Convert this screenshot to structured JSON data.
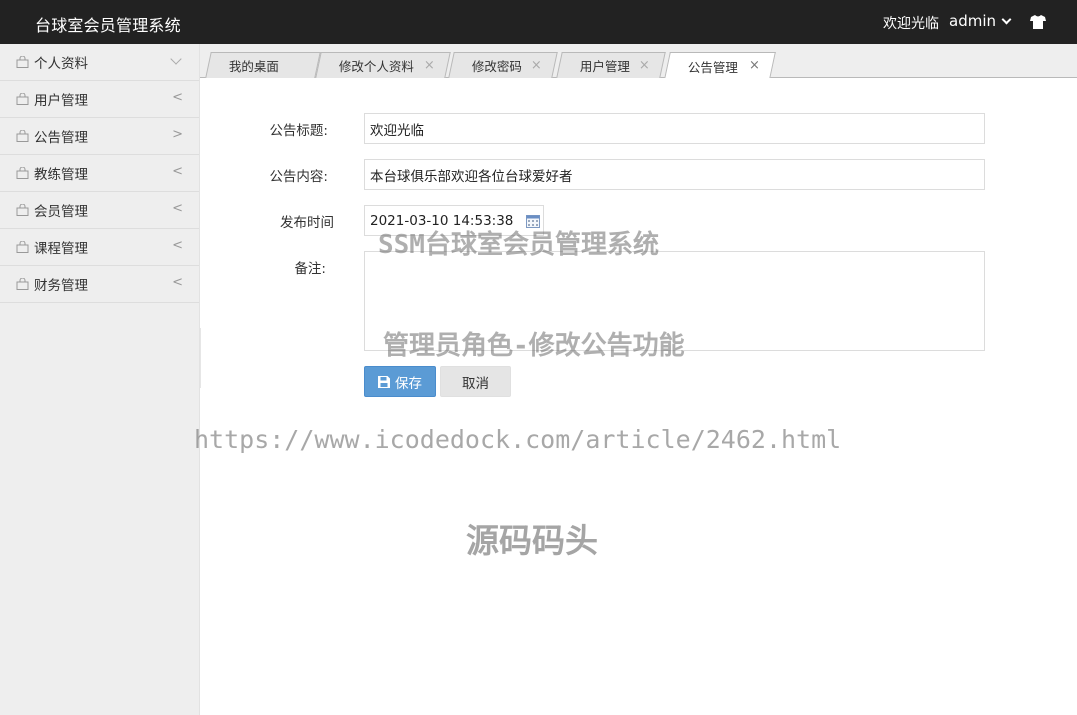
{
  "header": {
    "app_title": "台球室会员管理系统",
    "welcome": "欢迎光临",
    "username": "admin",
    "skin_icon": "tshirt-icon"
  },
  "sidebar": {
    "items": [
      {
        "label": "个人资料",
        "arrow": "v"
      },
      {
        "label": "用户管理",
        "arrow": "<"
      },
      {
        "label": "公告管理",
        "arrow": ">"
      },
      {
        "label": "教练管理",
        "arrow": "<"
      },
      {
        "label": "会员管理",
        "arrow": "<"
      },
      {
        "label": "课程管理",
        "arrow": "<"
      },
      {
        "label": "财务管理",
        "arrow": "<"
      }
    ]
  },
  "tabs": [
    {
      "label": "我的桌面",
      "closable": false,
      "active": false
    },
    {
      "label": "修改个人资料",
      "closable": true,
      "active": false
    },
    {
      "label": "修改密码",
      "closable": true,
      "active": false
    },
    {
      "label": "用户管理",
      "closable": true,
      "active": false
    },
    {
      "label": "公告管理",
      "closable": true,
      "active": true
    }
  ],
  "close_glyph": "×",
  "form": {
    "title_label": "公告标题:",
    "title_value": "欢迎光临",
    "content_label": "公告内容:",
    "content_value": "本台球俱乐部欢迎各位台球爱好者",
    "time_label": "发布时间",
    "time_value": "2021-03-10 14:53:38",
    "remark_label": "备注:",
    "remark_value": "",
    "save_label": "保存",
    "cancel_label": "取消"
  },
  "watermarks": {
    "line1": "SSM台球室会员管理系统",
    "line2": "管理员角色-修改公告功能",
    "line3": "https://www.icodedock.com/article/2462.html",
    "line4": "源码码头"
  }
}
